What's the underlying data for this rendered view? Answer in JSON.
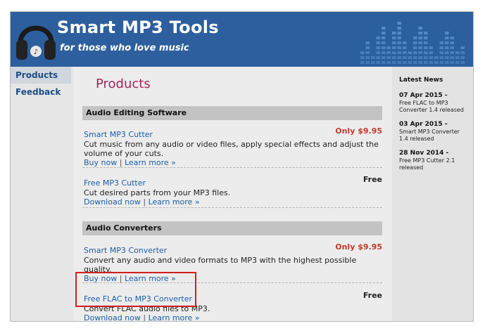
{
  "header": {
    "title": "Smart MP3 Tools",
    "tagline": "for those who love music"
  },
  "sidebar": {
    "items": [
      {
        "label": "Products",
        "active": true
      },
      {
        "label": "Feedback",
        "active": false
      }
    ]
  },
  "main": {
    "page_title": "Products",
    "sections": [
      {
        "title": "Audio Editing Software",
        "products": [
          {
            "name": "Smart MP3 Cutter",
            "price": "Only $9.95",
            "description": "Cut music from any audio or video files, apply special effects and adjust the volume of your cuts.",
            "primary_link": "Buy now",
            "separator": "|",
            "secondary_link": "Learn more »"
          },
          {
            "name": "Free MP3 Cutter",
            "price": "Free",
            "description": "Cut desired parts from your MP3 files.",
            "primary_link": "Download now",
            "separator": "|",
            "secondary_link": "Learn more »"
          }
        ]
      },
      {
        "title": "Audio Converters",
        "products": [
          {
            "name": "Smart MP3 Converter",
            "price": "Only $9.95",
            "description": "Convert any audio and video formats to MP3 with the highest possible quality.",
            "primary_link": "Buy now",
            "separator": "|",
            "secondary_link": "Learn more »"
          },
          {
            "name": "Free FLAC to MP3 Converter",
            "price": "Free",
            "description": "Convert FLAC audio files to MP3.",
            "primary_link": "Download now",
            "separator": "|",
            "secondary_link": "Learn more »"
          }
        ]
      }
    ]
  },
  "news": {
    "heading": "Latest News",
    "items": [
      {
        "date": "07 Apr 2015 -",
        "text": "Free FLAC to MP3 Converter 1.4 released"
      },
      {
        "date": "03 Apr 2015 -",
        "text": "Smart MP3 Converter 1.4 released"
      },
      {
        "date": "28 Nov 2014 -",
        "text": "Free MP3 Cutter 2.1 released"
      }
    ]
  },
  "colors": {
    "header_bg": "#2d5f9e",
    "link": "#1d5fa6",
    "page_title": "#a3275a",
    "paid_price": "#c33a2b",
    "highlight_border": "#d11f1f"
  },
  "icons": {
    "logo": "headphones-icon",
    "decoration": "equalizer-icon"
  }
}
